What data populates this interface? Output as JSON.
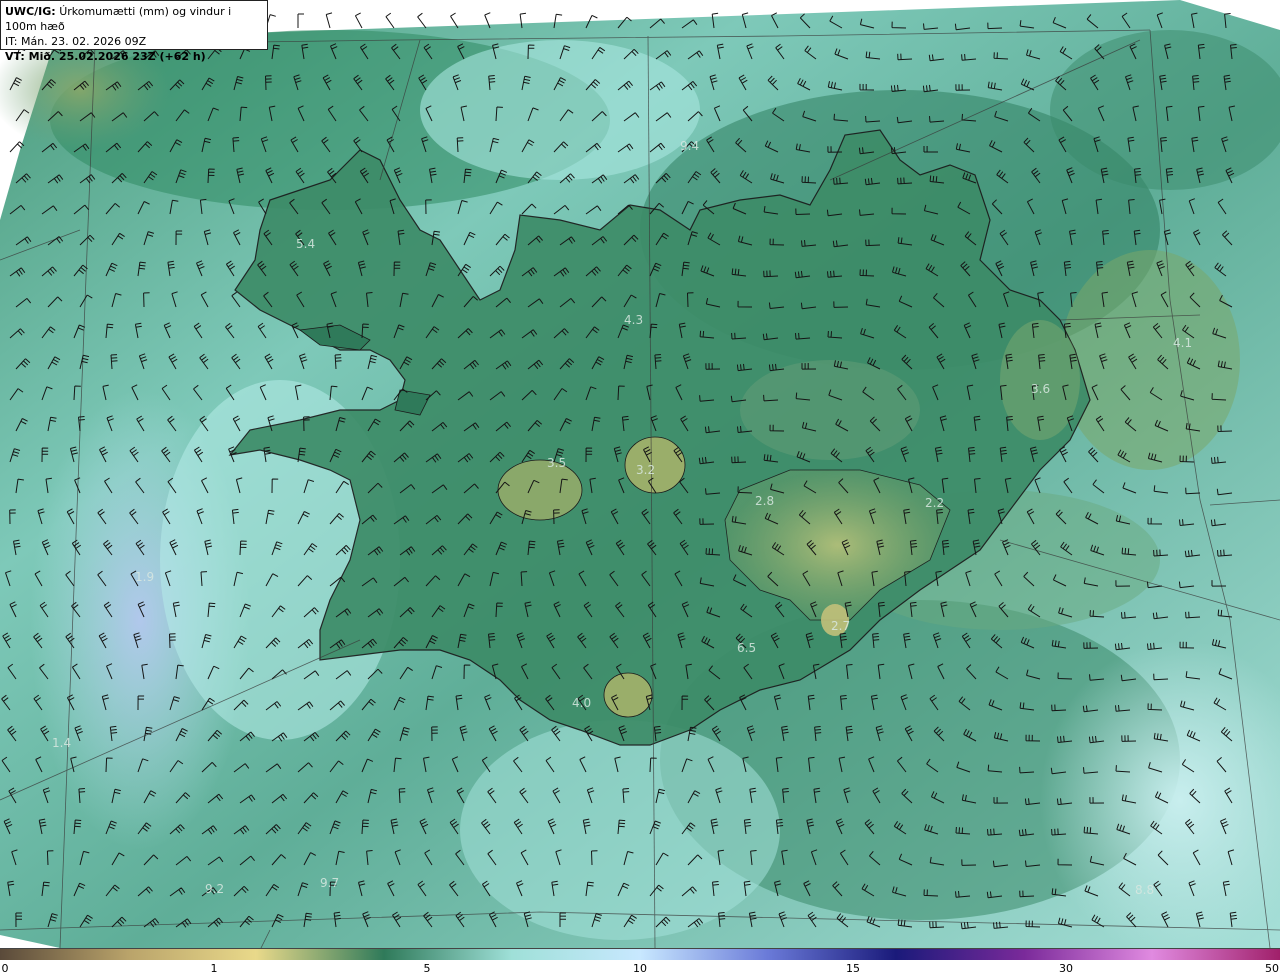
{
  "header": {
    "product": "UWC/IG:",
    "title": "Úrkomumætti (mm) og vindur i 100m hæð",
    "init_time": "IT: Mán. 23. 02. 2026 09Z",
    "valid_time": "VT: Mið. 25.02.2026 23Z (+62 h)"
  },
  "colorbar": {
    "ticks": [
      "0",
      "1",
      "5",
      "10",
      "15",
      "30",
      "50"
    ],
    "colors": [
      "#5a4a3a",
      "#b9a36a",
      "#e9d98a",
      "#2f7a5a",
      "#9fe0d8",
      "#c8e8ff",
      "#6a7ad8",
      "#1a1a7a",
      "#7a2a9a",
      "#e08ae0",
      "#a0206a"
    ]
  },
  "map_labels": [
    {
      "text": "5.4"
    },
    {
      "text": "4.3"
    },
    {
      "text": "3.5"
    },
    {
      "text": "3.2"
    },
    {
      "text": "2.8"
    },
    {
      "text": "2.2"
    },
    {
      "text": "3.6"
    },
    {
      "text": "4.1"
    },
    {
      "text": "2.7"
    },
    {
      "text": "4.0"
    },
    {
      "text": "9.4"
    },
    {
      "text": "6.5"
    },
    {
      "text": "1.9"
    },
    {
      "text": "1.4"
    },
    {
      "text": "9.2"
    },
    {
      "text": "9.7"
    },
    {
      "text": "8.8"
    }
  ],
  "legend_icons": [
    "wind-barb-icon"
  ]
}
